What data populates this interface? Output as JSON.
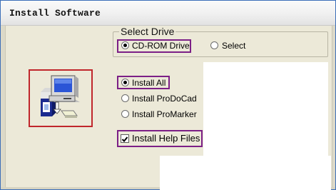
{
  "window": {
    "title": "Install Software"
  },
  "drive_group": {
    "legend": "Select Drive",
    "options": [
      {
        "label": "CD-ROM Drive",
        "selected": true
      },
      {
        "label": "Select",
        "selected": false
      }
    ]
  },
  "install_options": [
    {
      "label": "Install All",
      "selected": true
    },
    {
      "label": "Install ProDoCad",
      "selected": false
    },
    {
      "label": "Install ProMarker",
      "selected": false
    }
  ],
  "help_files": {
    "label": "Install Help Files",
    "checked": true
  },
  "icons": {
    "installer": "computer-install-icon"
  },
  "colors": {
    "highlight": "#7c1f86",
    "icon_frame": "#c0262b",
    "window_bg": "#ece9d8"
  }
}
